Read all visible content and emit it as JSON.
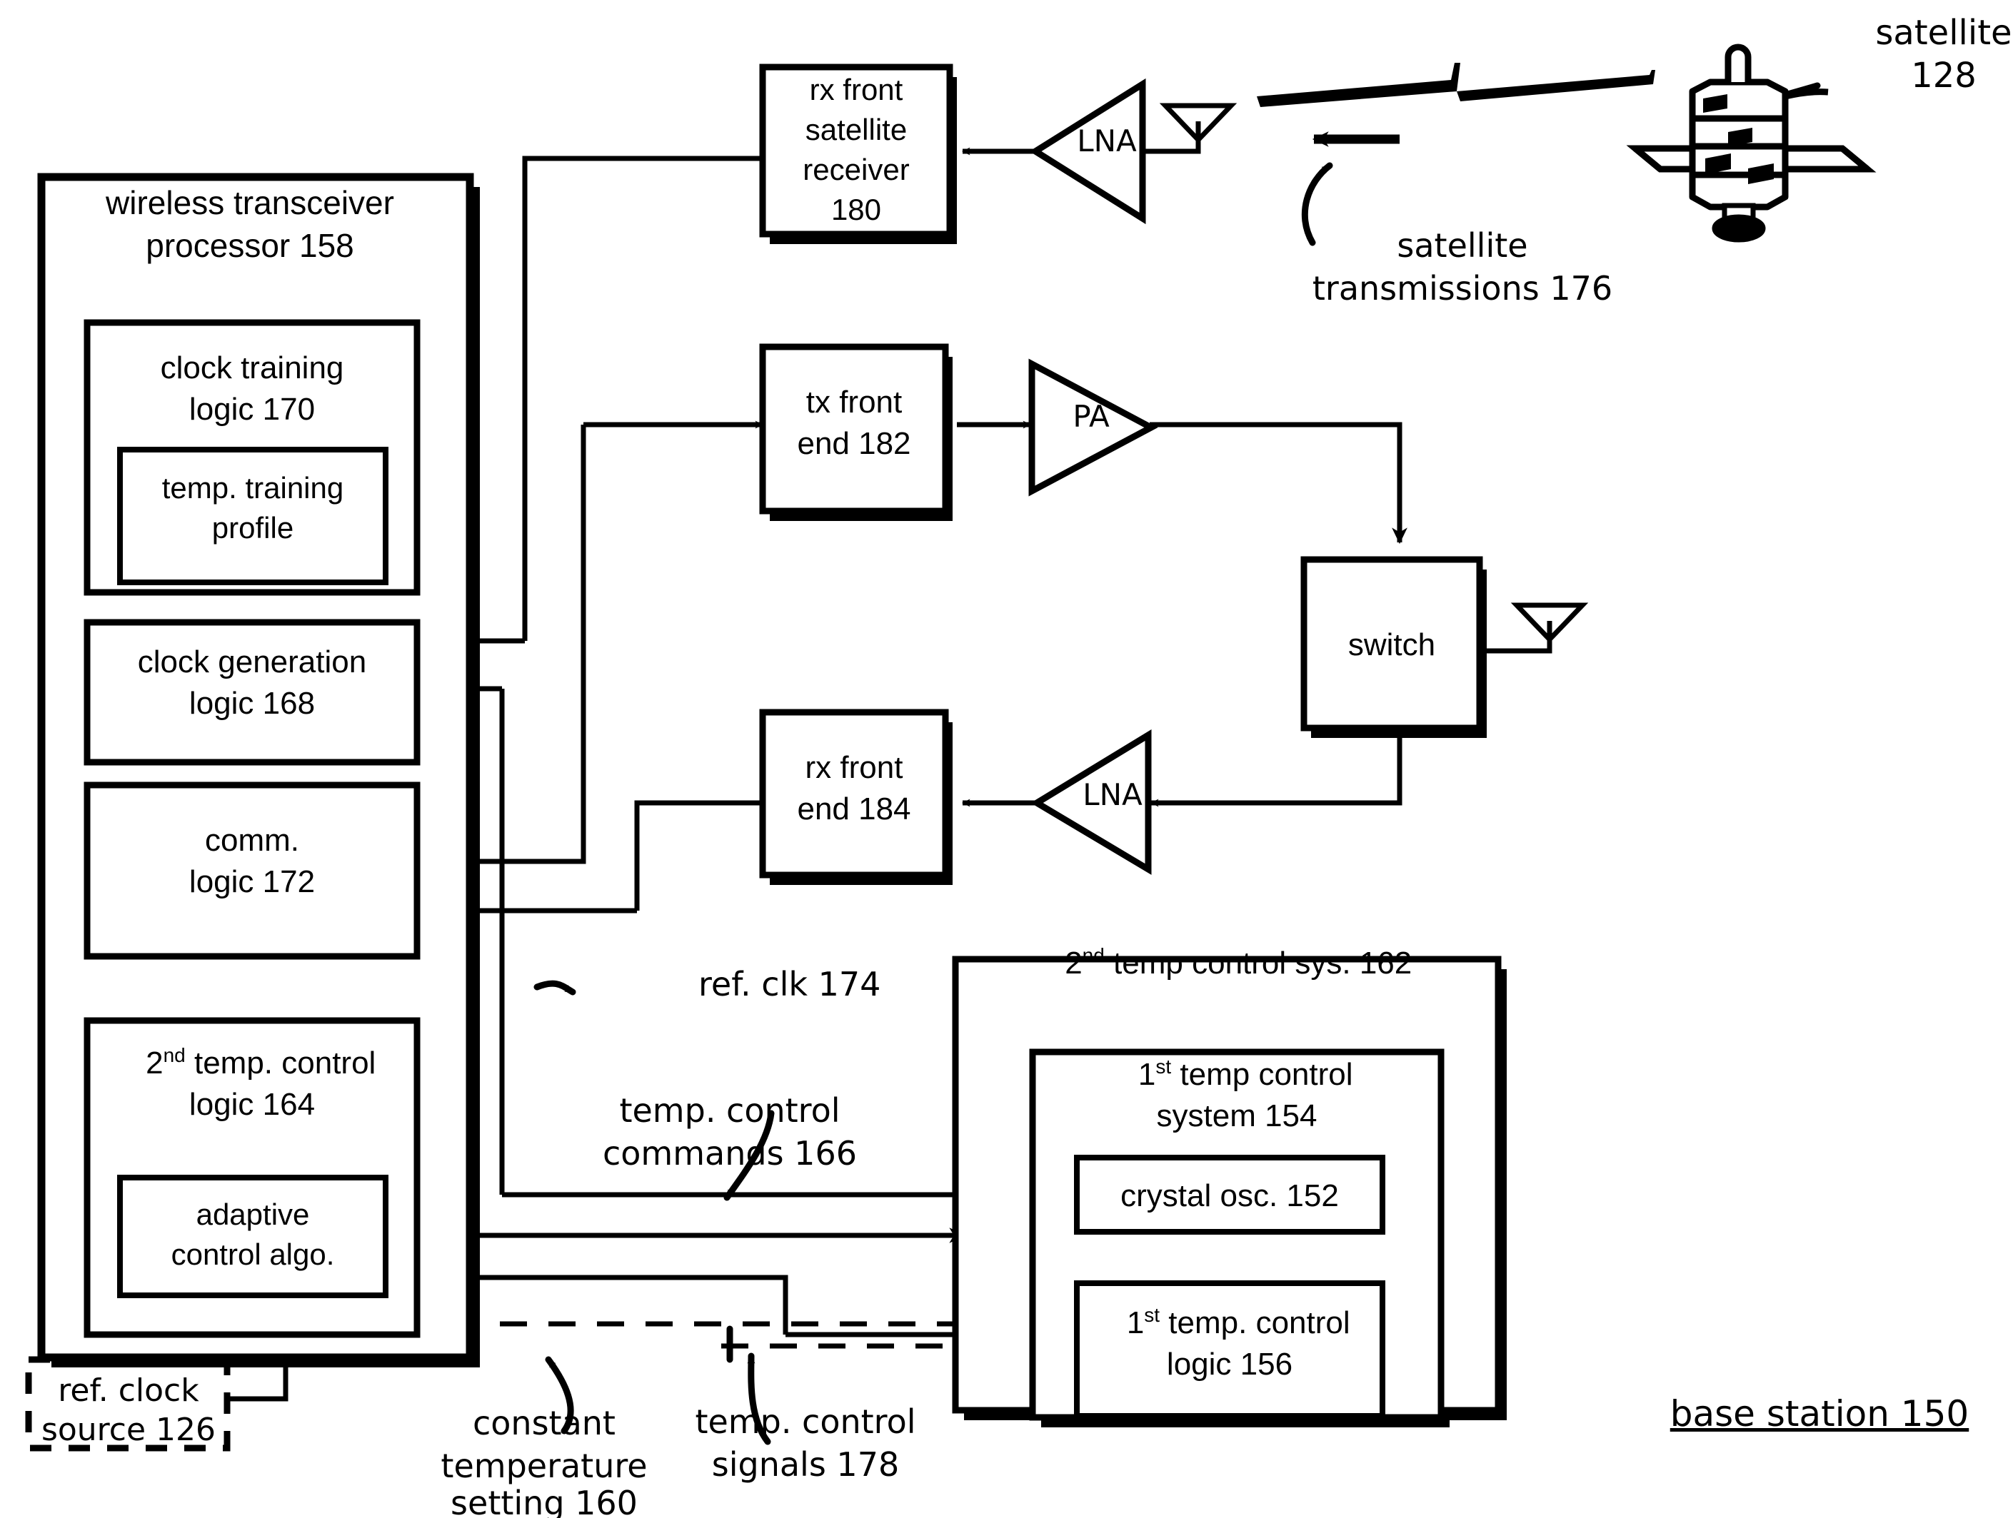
{
  "figure": {
    "kind": "patent-block-diagram",
    "stroke_color": "#000000",
    "background_color": "#ffffff"
  },
  "blocks": {
    "transceiver_processor": {
      "line1": "wireless transceiver",
      "line2": "processor 158"
    },
    "clock_training_logic": {
      "line1": "clock training",
      "line2": "logic 170"
    },
    "temp_training_profile": {
      "line1": "temp. training",
      "line2": "profile"
    },
    "clock_generation_logic": {
      "line1": "clock generation",
      "line2": "logic 168"
    },
    "comm_logic": {
      "line1": "comm.",
      "line2": "logic 172"
    },
    "second_temp_control_logic": {
      "sup_num": "2",
      "sup": "nd",
      "line1_rest": " temp. control",
      "line2": "logic 164"
    },
    "adaptive_control_algo": {
      "line1": "adaptive",
      "line2": "control algo."
    },
    "ref_clock_source": {
      "line1": "ref. clock",
      "line2": "source 126"
    },
    "rx_front_satellite_receiver": {
      "line1": "rx front",
      "line2": "satellite",
      "line3": "receiver",
      "line4": "180"
    },
    "tx_front_end": {
      "line1": "tx front",
      "line2": "end 182"
    },
    "rx_front_end": {
      "line1": "rx front",
      "line2": "end 184"
    },
    "switch": {
      "label": "switch"
    },
    "lna_top": {
      "label": "LNA"
    },
    "lna_bottom": {
      "label": "LNA"
    },
    "pa": {
      "label": "PA"
    },
    "second_temp_control_sys": {
      "sup_num": "2",
      "sup": "nd",
      "rest": " temp control sys. 162"
    },
    "first_temp_control_system": {
      "sup_num": "1",
      "sup": "st",
      "line1_rest": " temp control",
      "line2": "system 154"
    },
    "crystal_osc": {
      "label": "crystal osc. 152"
    },
    "first_temp_control_logic": {
      "sup_num": "1",
      "sup": "st",
      "line1_rest": " temp. control",
      "line2": "logic 156"
    }
  },
  "annotations": {
    "satellite": {
      "line1": "satellite",
      "line2": "128"
    },
    "satellite_transmissions": {
      "line1": "satellite",
      "line2": "transmissions 176"
    },
    "ref_clk": {
      "label": "ref. clk 174"
    },
    "temp_control_commands": {
      "line1": "temp. control",
      "line2": "commands 166"
    },
    "constant_temperature_setting": {
      "line1": "constant",
      "line2": "temperature",
      "line3": "setting 160"
    },
    "temp_control_signals": {
      "line1": "temp. control",
      "line2": "signals 178"
    },
    "base_station": {
      "label": "base station 150"
    }
  }
}
